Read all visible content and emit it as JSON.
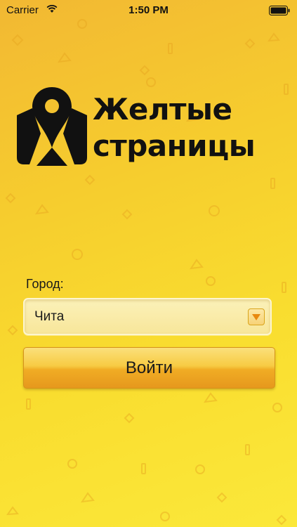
{
  "status_bar": {
    "carrier": "Carrier",
    "time": "1:50 PM",
    "wifi_icon": "wifi-icon",
    "battery_icon": "battery-icon"
  },
  "logo": {
    "line1": "Желтые",
    "line2": "страницы",
    "icon": "map-pin-logo-icon"
  },
  "form": {
    "city_label": "Город:",
    "city_value": "Чита",
    "dropdown_icon": "dropdown-arrow-icon",
    "login_label": "Войти"
  },
  "colors": {
    "background_top": "#f2b833",
    "background_bottom": "#fbe83a",
    "button": "#f0ac24",
    "select_field": "#fbf1b9",
    "dropdown_arrow": "#e8890f"
  }
}
